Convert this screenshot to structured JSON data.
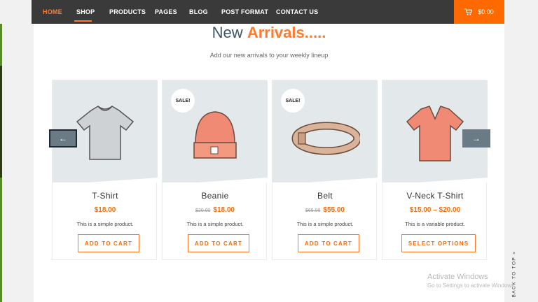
{
  "nav": {
    "items": [
      {
        "label": "HOME",
        "active": true
      },
      {
        "label": "SHOP",
        "active": false
      },
      {
        "label": "PRODUCTS",
        "active": false
      },
      {
        "label": "PAGES",
        "active": false
      },
      {
        "label": "BLOG",
        "active": false
      },
      {
        "label": "POST FORMAT",
        "active": false
      },
      {
        "label": "CONTACT US",
        "active": false
      }
    ],
    "cart": {
      "icon": "shopping-cart-icon",
      "total": "$0.00"
    }
  },
  "section": {
    "title_part1": "New",
    "title_part2": "Arrivals.....",
    "subtitle": "Add our new arrivals to your weekly lineup"
  },
  "carousel": {
    "prev_label": "←",
    "next_label": "→"
  },
  "products": [
    {
      "name": "T-Shirt",
      "price": "$18.00",
      "old_price": "",
      "sale_badge": "",
      "description": "This is a simple product.",
      "button": "ADD TO CART",
      "image": "tshirt-image"
    },
    {
      "name": "Beanie",
      "price": "$18.00",
      "old_price": "$20.00",
      "sale_badge": "SALE!",
      "description": "This is a simple product.",
      "button": "ADD TO CART",
      "image": "beanie-image"
    },
    {
      "name": "Belt",
      "price": "$55.00",
      "old_price": "$65.00",
      "sale_badge": "SALE!",
      "description": "This is a simple product.",
      "button": "ADD TO CART",
      "image": "belt-image"
    },
    {
      "name": "V-Neck T-Shirt",
      "price": "$15.00 – $20.00",
      "old_price": "",
      "sale_badge": "",
      "description": "This is a variable product.",
      "button": "SELECT OPTIONS",
      "image": "vneck-image"
    }
  ],
  "back_to_top": "BACK TO TOP »",
  "watermark": {
    "line1": "Activate Windows",
    "line2": "Go to Settings to activate Windows."
  },
  "colors": {
    "accent": "#ff6a00",
    "nav_bg": "#3a3a3a",
    "title_dark": "#3d5566",
    "arrow_bg": "#6b7b86"
  }
}
